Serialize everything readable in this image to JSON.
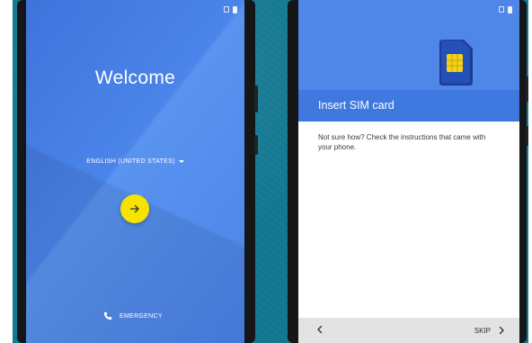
{
  "welcome_screen": {
    "title": "Welcome",
    "language": "ENGLISH (UNITED STATES)",
    "next_icon": "arrow-right-icon",
    "emergency_label": "EMERGENCY",
    "emergency_icon": "phone-icon"
  },
  "sim_screen": {
    "title": "Insert SIM card",
    "body": "Not sure how? Check the instructions that came with your phone.",
    "back_icon": "chevron-left-icon",
    "skip_label": "SKIP",
    "skip_icon": "chevron-right-icon",
    "sim_icon": "sim-card-icon"
  },
  "colors": {
    "background": "#147a94",
    "welcome_blue": "#4a82e8",
    "header_blue": "#3f78de",
    "next_button": "#f6e400"
  }
}
